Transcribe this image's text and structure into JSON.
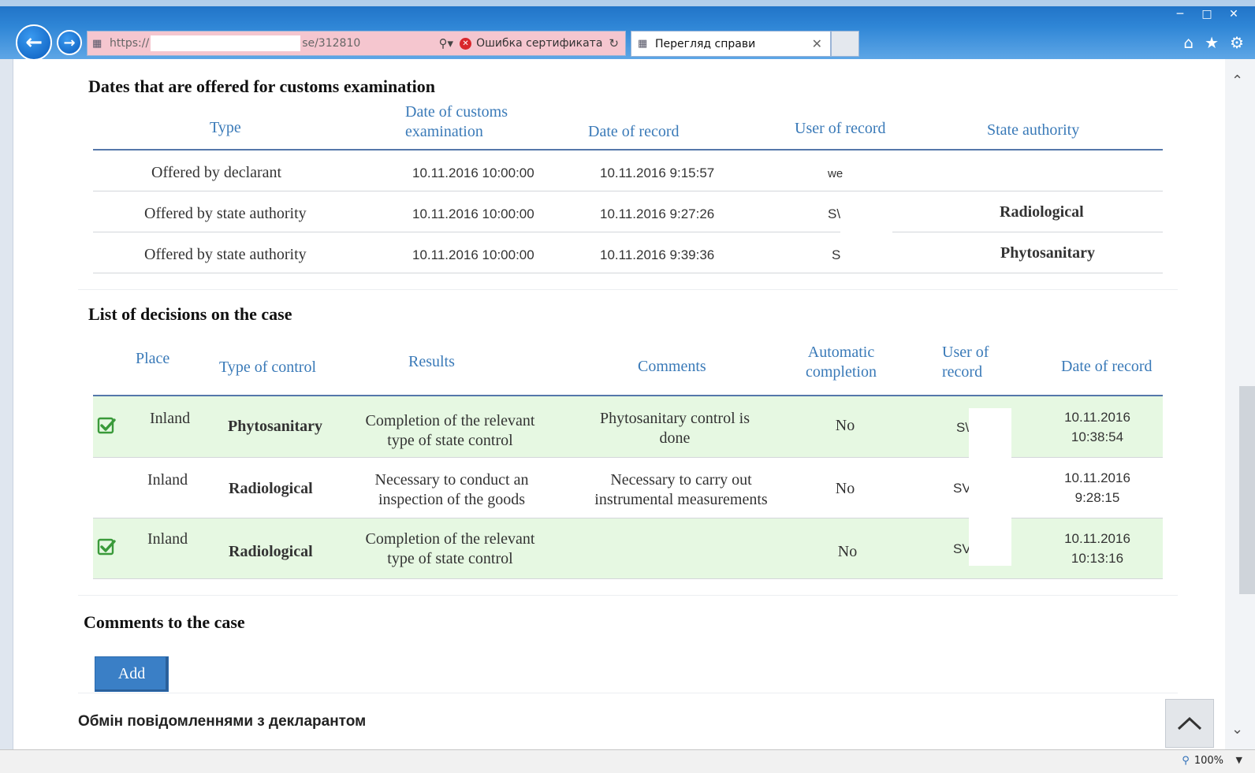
{
  "browser": {
    "url_start": "https://",
    "url_end": "se/312810",
    "cert_error": "Ошибка сертификата",
    "tab_title": "Перегляд справи",
    "zoom": "100%"
  },
  "dates_section": {
    "title": "Dates that are offered for customs examination",
    "headers": {
      "type": "Type",
      "date_exam_1": "Date of customs",
      "date_exam_2": "examination",
      "date_record": "Date of record",
      "user": "User of record",
      "authority": "State authority"
    },
    "rows": [
      {
        "type": "Offered by declarant",
        "date_exam": "10.11.2016 10:00:00",
        "date_record": "10.11.2016 9:15:57",
        "user": "we",
        "authority": ""
      },
      {
        "type": "Offered by state authority",
        "date_exam": "10.11.2016 10:00:00",
        "date_record": "10.11.2016 9:27:26",
        "user": "S\\",
        "authority": "Radiological"
      },
      {
        "type": "Offered by state authority",
        "date_exam": "10.11.2016 10:00:00",
        "date_record": "10.11.2016 9:39:36",
        "user": "S",
        "authority": "Phytosanitary"
      }
    ]
  },
  "decisions_section": {
    "title": "List of decisions on the case",
    "headers": {
      "place": "Place",
      "type_control": "Type of control",
      "results": "Results",
      "comments": "Comments",
      "auto_1": "Automatic",
      "auto_2": "completion",
      "user_1": "User of",
      "user_2": "record",
      "date_record": "Date of record"
    },
    "rows": [
      {
        "checked": true,
        "place": "Inland",
        "type_control": "Phytosanitary",
        "results_1": "Completion of the relevant",
        "results_2": "type of state control",
        "comments_1": "Phytosanitary control is",
        "comments_2": "done",
        "auto": "No",
        "user": "S\\",
        "date_1": "10.11.2016",
        "date_2": "10:38:54"
      },
      {
        "checked": false,
        "place": "Inland",
        "type_control": "Radiological",
        "results_1": "Necessary to conduct an",
        "results_2": "inspection of the goods",
        "comments_1": "Necessary to carry out",
        "comments_2": "instrumental measurements",
        "auto": "No",
        "user": "SV",
        "date_1": "10.11.2016",
        "date_2": "9:28:15"
      },
      {
        "checked": true,
        "place": "Inland",
        "type_control": "Radiological",
        "results_1": "Completion of the relevant",
        "results_2": "type of state control",
        "comments_1": "",
        "comments_2": "",
        "auto": "No",
        "user": "SV",
        "date_1": "10.11.2016",
        "date_2": "10:13:16"
      }
    ]
  },
  "comments_section": {
    "title": "Comments to the case",
    "add_label": "Add"
  },
  "messages_section": {
    "title": "Обмін повідомленнями з декларантом"
  },
  "colors": {
    "header_blue": "#3a7ab8",
    "checked_row_bg": "#e6f8e2",
    "button_blue": "#3a7fc6"
  }
}
